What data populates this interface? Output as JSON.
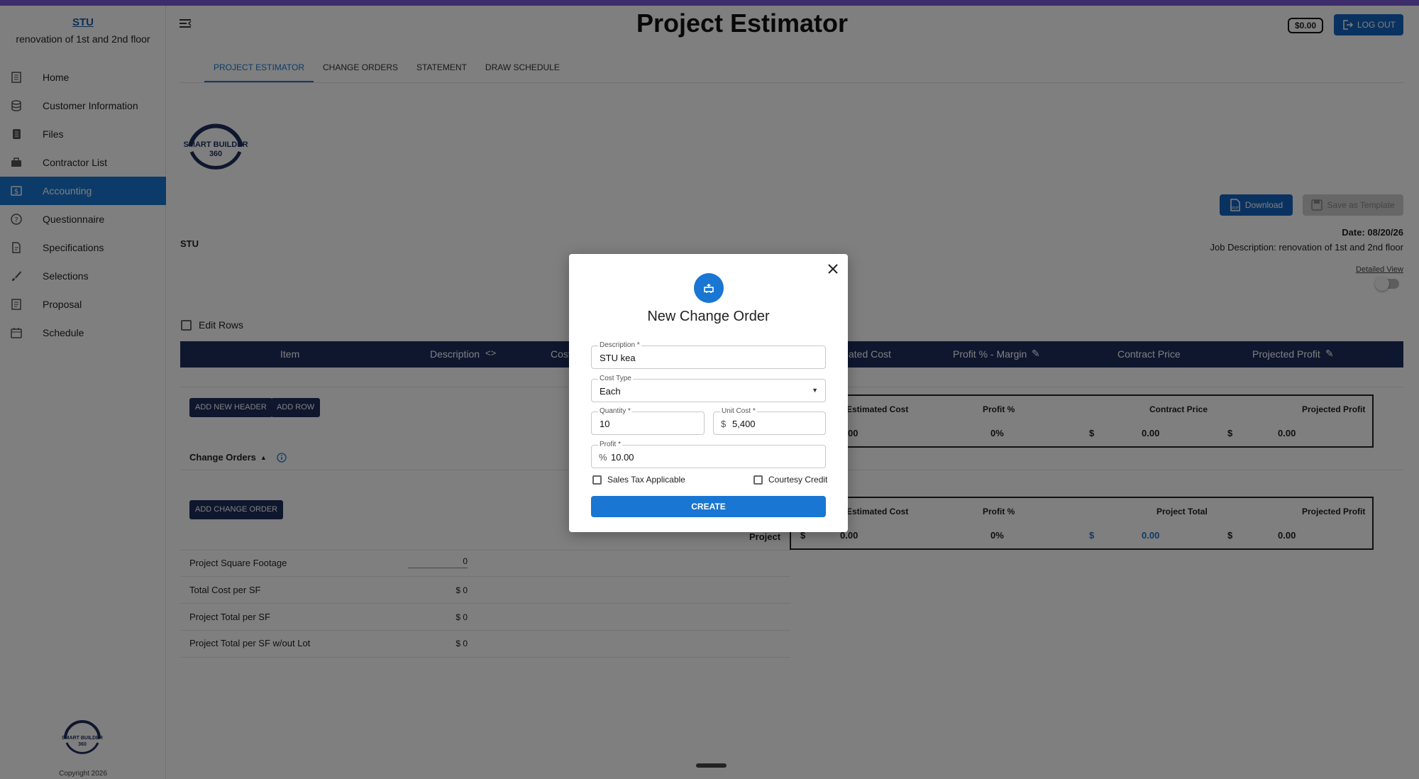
{
  "sidebar": {
    "project_name": "STU",
    "project_desc": "renovation of 1st and 2nd floor",
    "items": [
      {
        "label": "Home",
        "icon": "home-icon"
      },
      {
        "label": "Customer Information",
        "icon": "database-icon"
      },
      {
        "label": "Files",
        "icon": "files-icon"
      },
      {
        "label": "Contractor List",
        "icon": "briefcase-icon"
      },
      {
        "label": "Accounting",
        "icon": "dollar-icon",
        "active": true
      },
      {
        "label": "Questionnaire",
        "icon": "question-icon"
      },
      {
        "label": "Specifications",
        "icon": "specifications-icon"
      },
      {
        "label": "Selections",
        "icon": "brush-icon"
      },
      {
        "label": "Proposal",
        "icon": "proposal-icon"
      },
      {
        "label": "Schedule",
        "icon": "calendar-icon"
      }
    ],
    "logo_text": "SMART BUILDER 360",
    "copyright": "Copyright 2026"
  },
  "header": {
    "title": "Project Estimator",
    "balance": "$0.00",
    "logout": "LOG OUT"
  },
  "tabs": [
    {
      "label": "PROJECT ESTIMATOR",
      "active": true
    },
    {
      "label": "CHANGE ORDERS"
    },
    {
      "label": "STATEMENT"
    },
    {
      "label": "DRAW SCHEDULE"
    }
  ],
  "main": {
    "logo_text": "SMART BUILDER 360",
    "download": "Download",
    "save_template": "Save as Template",
    "date": "Date: 08/20/26",
    "job_description": "Job Description: renovation of 1st and 2nd floor",
    "detailed_view": "Detailed View",
    "client": "STU",
    "edit_rows": "Edit Rows",
    "table_headers": {
      "item": "Item",
      "description": "Description",
      "cost": "Cost",
      "estimated_cost": "ated Cost",
      "profit_margin": "Profit % - Margin",
      "contract_price": "Contract Price",
      "projected_profit": "Projected Profit"
    },
    "add_new_header": "ADD NEW HEADER",
    "add_row": "ADD ROW",
    "change_orders": "Change Orders",
    "add_change_order": "ADD CHANGE ORDER",
    "summary1": {
      "h_est": "Estimated Cost",
      "h_profit": "Profit %",
      "h_contract": "Contract Price",
      "h_projected": "Projected Profit",
      "v_est": "00",
      "v_profit": "0%",
      "v_contract_sym": "$",
      "v_contract": "0.00",
      "v_projected_sym": "$",
      "v_projected": "0.00"
    },
    "summary2": {
      "row_label": "Project",
      "h_est": "Estimated Cost",
      "h_profit": "Profit %",
      "h_total": "Project Total",
      "h_projected": "Projected Profit",
      "v_est_sym": "$",
      "v_est": "0.00",
      "v_profit": "0%",
      "v_total_sym": "$",
      "v_total": "0.00",
      "v_projected_sym": "$",
      "v_projected": "0.00"
    },
    "stats": [
      {
        "label": "Project Square Footage",
        "value": "0"
      },
      {
        "label": "Total Cost per SF",
        "value": "$ 0"
      },
      {
        "label": "Project Total per SF",
        "value": "$ 0"
      },
      {
        "label": "Project Total per SF w/out Lot",
        "value": "$ 0"
      }
    ]
  },
  "modal": {
    "title": "New Change Order",
    "description_label": "Description *",
    "description_value": "STU kea",
    "cost_type_label": "Cost Type",
    "cost_type_value": "Each",
    "quantity_label": "Quantity *",
    "quantity_value": "10",
    "unit_cost_label": "Unit Cost *",
    "unit_cost_prefix": "$",
    "unit_cost_value": "5,400",
    "profit_label": "Profit *",
    "profit_prefix": "%",
    "profit_value": "10.00",
    "sales_tax": "Sales Tax Applicable",
    "courtesy_credit": "Courtesy Credit",
    "create": "CREATE"
  },
  "colors": {
    "accent": "#1976d2",
    "navy": "#1e2f5e",
    "top_bar": "#7b5bd6"
  }
}
